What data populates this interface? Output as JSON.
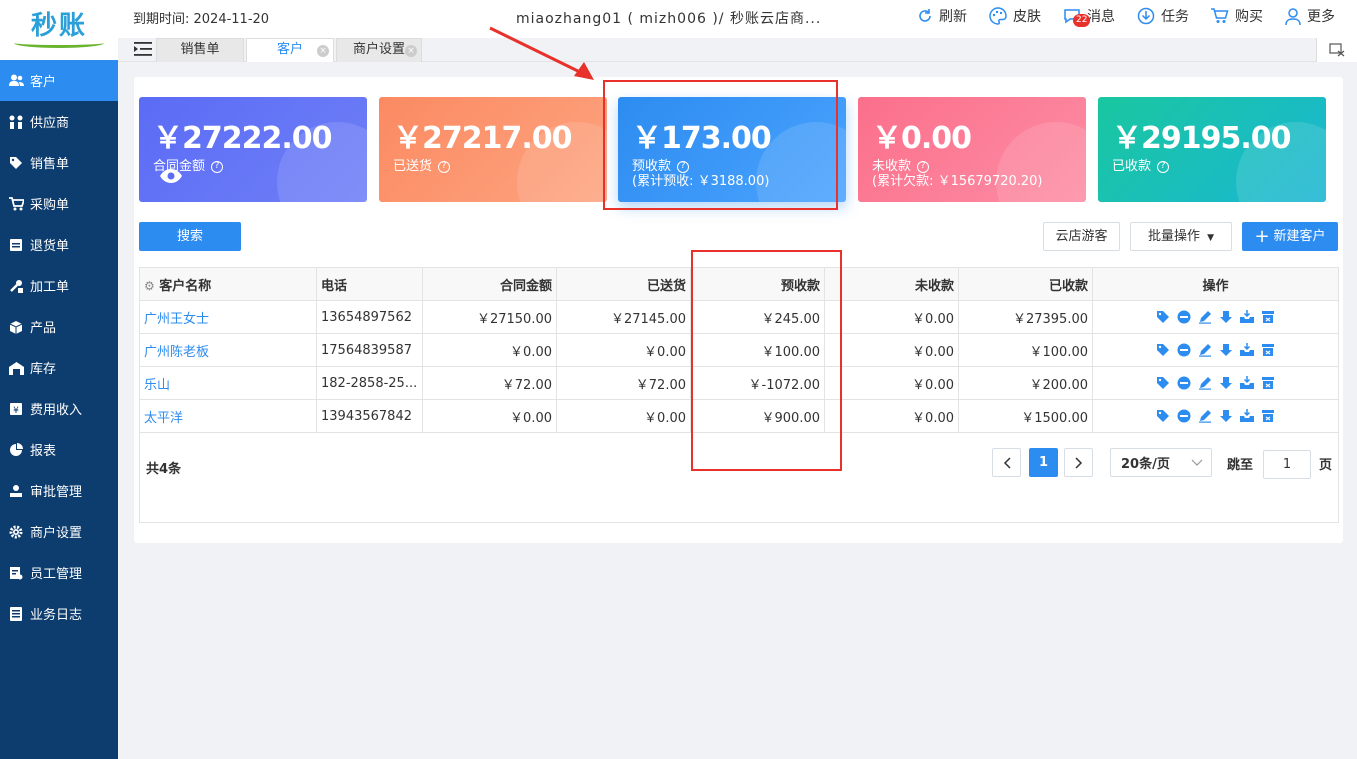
{
  "logo": {
    "text": "秒账"
  },
  "sidebar": {
    "items": [
      {
        "label": "客户",
        "icon": "users-icon",
        "active": true
      },
      {
        "label": "供应商",
        "icon": "supplier-icon"
      },
      {
        "label": "销售单",
        "icon": "tag-icon"
      },
      {
        "label": "采购单",
        "icon": "cart-icon"
      },
      {
        "label": "退货单",
        "icon": "return-icon"
      },
      {
        "label": "加工单",
        "icon": "tools-icon"
      },
      {
        "label": "产品",
        "icon": "box-icon"
      },
      {
        "label": "库存",
        "icon": "warehouse-icon"
      },
      {
        "label": "费用收入",
        "icon": "money-icon"
      },
      {
        "label": "报表",
        "icon": "pie-chart-icon"
      },
      {
        "label": "审批管理",
        "icon": "approval-icon"
      },
      {
        "label": "商户设置",
        "icon": "gear-icon"
      },
      {
        "label": "员工管理",
        "icon": "staff-icon"
      },
      {
        "label": "业务日志",
        "icon": "log-icon"
      }
    ]
  },
  "header": {
    "expire": "到期时间: 2024-11-20",
    "account": "miaozhang01 ( mizh006 )/ 秒账云店商...",
    "tools": {
      "refresh": "刷新",
      "skin": "皮肤",
      "message": "消息",
      "message_count": "22",
      "task": "任务",
      "buy": "购买",
      "more": "更多"
    }
  },
  "tabs": [
    {
      "label": "销售单",
      "active": false
    },
    {
      "label": "客户",
      "active": true
    },
    {
      "label": "商户设置",
      "active": false
    }
  ],
  "cards": [
    {
      "amount": "￥27222.00",
      "label": "合同金额",
      "sub": "",
      "color1": "#5b6cf5",
      "color2": "#6f7ff7"
    },
    {
      "amount": "￥27217.00",
      "label": "已送货",
      "sub": "",
      "color1": "#fb8a62",
      "color2": "#fda480"
    },
    {
      "amount": "￥173.00",
      "label": "预收款",
      "sub": "(累计预收: ￥3188.00)",
      "color1": "#2d8cf0",
      "color2": "#4aa3ff"
    },
    {
      "amount": "￥0.00",
      "label": "未收款",
      "sub": "(累计欠款: ￥15679720.20)",
      "color1": "#fb6f8c",
      "color2": "#fd8da3"
    },
    {
      "amount": "￥29195.00",
      "label": "已收款",
      "sub": "",
      "color1": "#19c7a0",
      "color2": "#1bb6d4"
    }
  ],
  "actions": {
    "search": "搜索",
    "cloud_visitor": "云店游客",
    "batch": "批量操作",
    "new_customer": "新建客户"
  },
  "table": {
    "headers": [
      "客户名称",
      "电话",
      "合同金额",
      "已送货",
      "预收款",
      "未收款",
      "已收款",
      "操作"
    ],
    "rows": [
      [
        "广州王女士",
        "13654897562",
        "￥27150.00",
        "￥27145.00",
        "￥245.00",
        "￥0.00",
        "￥27395.00"
      ],
      [
        "广州陈老板",
        "17564839587",
        "￥0.00",
        "￥0.00",
        "￥100.00",
        "￥0.00",
        "￥100.00"
      ],
      [
        "乐山",
        "182-2858-25...",
        "￥72.00",
        "￥72.00",
        "￥-1072.00",
        "￥0.00",
        "￥200.00"
      ],
      [
        "太平洋",
        "13943567842",
        "￥0.00",
        "￥0.00",
        "￥900.00",
        "￥0.00",
        "￥1500.00"
      ]
    ]
  },
  "pagination": {
    "total": "共4条",
    "current": "1",
    "page_size": "20条/页",
    "jump_label": "跳至",
    "jump_value": "1",
    "page_unit": "页"
  },
  "colors": {
    "sidebar": "#0d3c6e",
    "primary": "#2d8cf0",
    "annotation": "#e8312a"
  }
}
